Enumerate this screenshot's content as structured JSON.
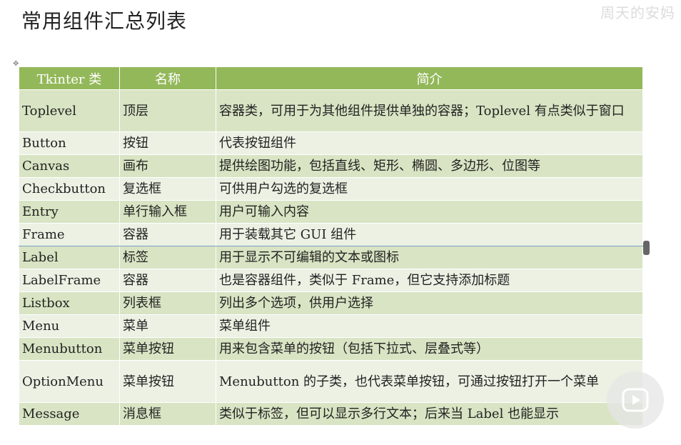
{
  "page": {
    "title": "常用组件汇总列表",
    "watermark_top": "周天的安妈"
  },
  "table": {
    "headers": [
      "Tkinter 类",
      "名称",
      "简介"
    ],
    "rows": [
      {
        "cls": "Toplevel",
        "name": "顶层",
        "desc": "容器类，可用于为其他组件提供单独的容器；Toplevel 有点类似于窗口"
      },
      {
        "cls": "Button",
        "name": "按钮",
        "desc": "代表按钮组件"
      },
      {
        "cls": "Canvas",
        "name": "画布",
        "desc": "提供绘图功能，包括直线、矩形、椭圆、多边形、位图等"
      },
      {
        "cls": "Checkbutton",
        "name": "复选框",
        "desc": "可供用户勾选的复选框"
      },
      {
        "cls": "Entry",
        "name": "单行输入框",
        "desc": "用户可输入内容"
      },
      {
        "cls": "Frame",
        "name": "容器",
        "desc": "用于装载其它 GUI 组件"
      },
      {
        "cls": "Label",
        "name": "标签",
        "desc": "用于显示不可编辑的文本或图标"
      },
      {
        "cls": "LabelFrame",
        "name": "容器",
        "desc": "也是容器组件，类似于 Frame，但它支持添加标题"
      },
      {
        "cls": "Listbox",
        "name": "列表框",
        "desc": "列出多个选项，供用户选择"
      },
      {
        "cls": "Menu",
        "name": "菜单",
        "desc": "菜单组件"
      },
      {
        "cls": "Menubutton",
        "name": "菜单按钮",
        "desc": "用来包含菜单的按钮（包括下拉式、层叠式等）"
      },
      {
        "cls": "OptionMenu",
        "name": "菜单按钮",
        "desc": "Menubutton 的子类，也代表菜单按钮，可通过按钮打开一个菜单"
      },
      {
        "cls": "Message",
        "name": "消息框",
        "desc": "类似于标签，但可以显示多行文本；后来当 Label 也能显示"
      }
    ]
  },
  "colors": {
    "header_bg": "#93b85a",
    "row_odd": "#d8e4c3",
    "row_even": "#ecf1e4"
  },
  "icons": {
    "play": "play-icon",
    "anchor": "anchor-icon"
  }
}
